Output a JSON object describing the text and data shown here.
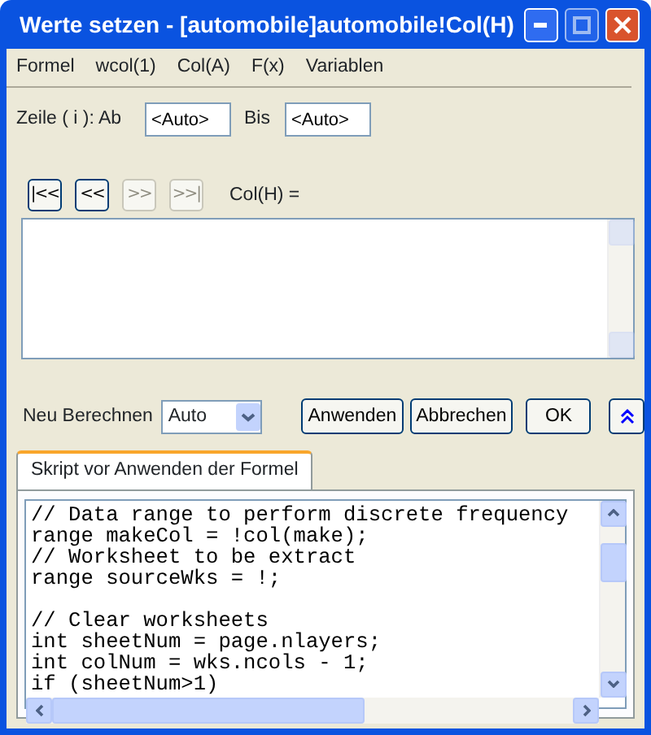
{
  "window": {
    "title": "Werte setzen - [automobile]automobile!Col(H)"
  },
  "menu": [
    "Formel",
    "wcol(1)",
    "Col(A)",
    "F(x)",
    "Variablen"
  ],
  "row_range": {
    "label": "Zeile ( i ): Ab",
    "from": "<Auto>",
    "to_label": "Bis",
    "to": "<Auto>"
  },
  "nav_buttons": [
    {
      "label": "|<<",
      "disabled": false
    },
    {
      "label": "<<",
      "disabled": false
    },
    {
      "label": ">>",
      "disabled": true
    },
    {
      "label": ">>|",
      "disabled": true
    }
  ],
  "column_label": "Col(H) =",
  "recalculate": {
    "label": "Neu Berechnen",
    "value": "Auto"
  },
  "buttons": [
    "Anwenden",
    "Abbrechen",
    "OK"
  ],
  "tabs": [
    {
      "label": "Skript vor Anwenden der Formel",
      "selected": true
    }
  ],
  "script_blocks": [
    [
      "// Data range to perform discrete frequency",
      "range makeCol = !col(make);",
      "// Worksheet to be extract",
      "range sourceWks = !;"
    ],
    [
      "// Clear worksheets",
      "int sheetNum = page.nlayers;",
      "int colNum = wks.ncols - 1;",
      "if (sheetNum>1)"
    ]
  ]
}
